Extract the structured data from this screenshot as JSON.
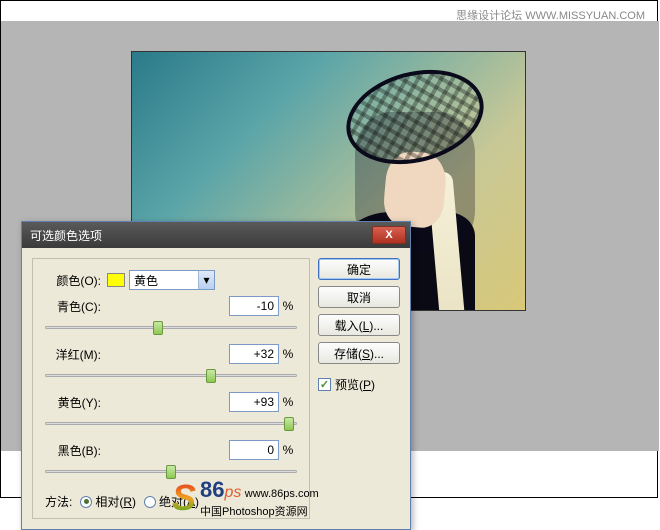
{
  "watermark_top": "思缘设计论坛  WWW.MISSYUAN.COM",
  "dialog": {
    "title": "可选颜色选项",
    "close": "X",
    "color_label": "颜色(O):",
    "color_value": "黄色",
    "sliders": [
      {
        "label": "青色(C):",
        "value": "-10",
        "pct": "%",
        "pos": 45
      },
      {
        "label": "洋红(M):",
        "value": "+32",
        "pct": "%",
        "pos": 66
      },
      {
        "label": "黄色(Y):",
        "value": "+93",
        "pct": "%",
        "pos": 97
      },
      {
        "label": "黑色(B):",
        "value": "0",
        "pct": "%",
        "pos": 50
      }
    ],
    "method_label": "方法:",
    "relative": "相对(R)",
    "absolute": "绝对(A)",
    "ok": "确定",
    "cancel": "取消",
    "load": "载入(L)...",
    "save": "存储(S)...",
    "preview": "预览(P)"
  },
  "logo": {
    "num": "86",
    "ps": "ps",
    "url": "www.86ps.com",
    "caption": "中国Photoshop资源网"
  }
}
